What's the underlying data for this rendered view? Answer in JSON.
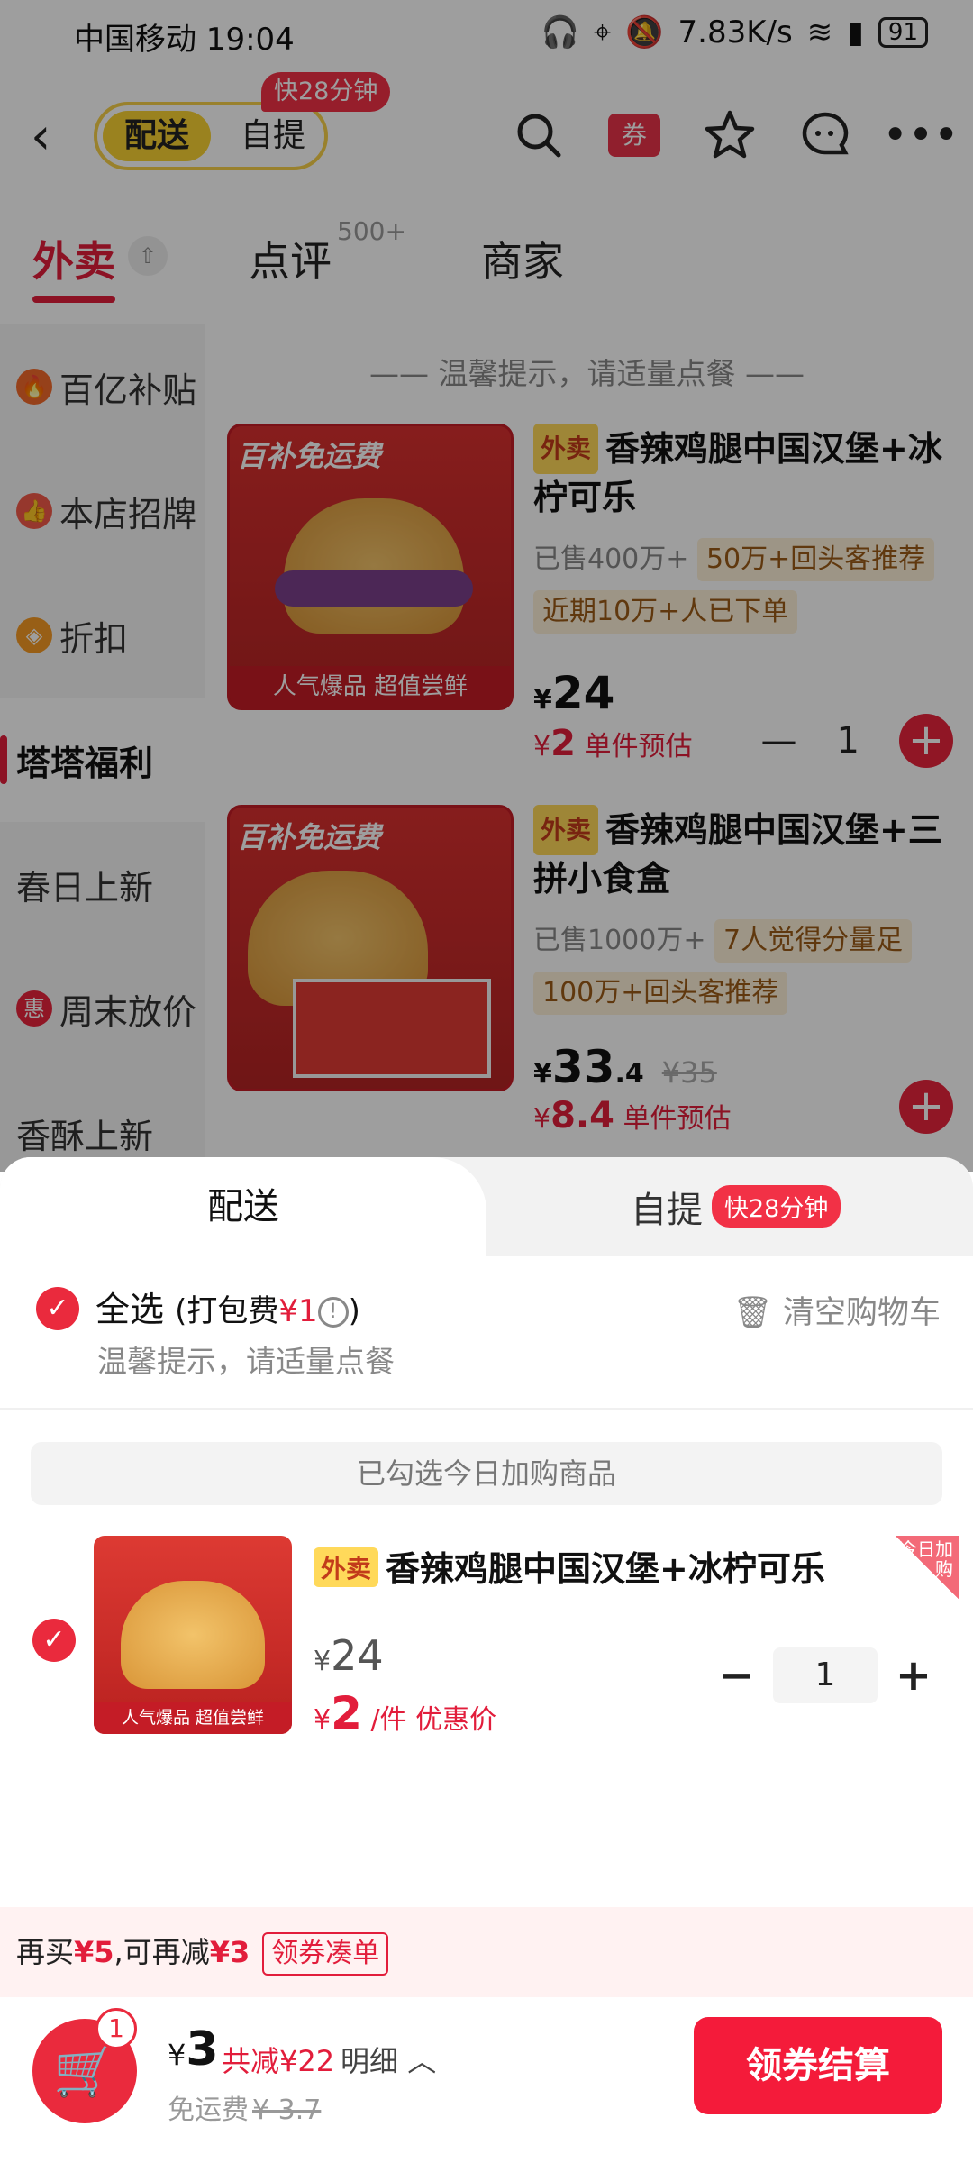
{
  "status_bar": {
    "carrier_time": "中国移动 19:04",
    "net_speed": "7.83K/s",
    "battery": "91"
  },
  "nav": {
    "mode_delivery": "配送",
    "mode_pickup": "自提",
    "fast_badge": "快28分钟",
    "coupon_icon_label": "券"
  },
  "tabs": [
    {
      "label": "外卖"
    },
    {
      "label": "点评",
      "sup": "500+"
    },
    {
      "label": "商家"
    }
  ],
  "sidebar": {
    "items": [
      {
        "label": "百亿补贴",
        "icon": "fire-icon",
        "color": "#f36a2a"
      },
      {
        "label": "本店招牌",
        "icon": "thumb-up-icon",
        "color": "#f35a4a"
      },
      {
        "label": "折扣",
        "icon": "discount-icon",
        "color": "#f59a24"
      },
      {
        "label": "塔塔福利",
        "icon": "",
        "color": ""
      },
      {
        "label": "春日上新",
        "icon": "",
        "color": ""
      },
      {
        "label": "周末放价",
        "icon": "hui-icon",
        "color": "#e8243c",
        "badge": "惠"
      },
      {
        "label": "香酥上新",
        "icon": "",
        "color": ""
      }
    ]
  },
  "menu": {
    "tip": "—— 温馨提示，请适量点餐 ——",
    "products": [
      {
        "ribbon": "百补免运费",
        "slogan": "人气爆品 超值尝鲜",
        "tag": "外卖",
        "title": "香辣鸡腿中国汉堡+冰柠可乐",
        "sold": "已售400万+",
        "chips": [
          "50万+回头客推荐",
          "近期10万+人已下单"
        ],
        "price_symbol": "¥",
        "price": "24",
        "est_symbol": "¥",
        "est_price": "2",
        "est_label": "单件预估",
        "qty": "1"
      },
      {
        "ribbon": "百补免运费",
        "tag": "外卖",
        "title": "香辣鸡腿中国汉堡+三拼小食盒",
        "sold": "已售1000万+",
        "chips": [
          "7人觉得分量足",
          "100万+回头客推荐"
        ],
        "price_symbol": "¥",
        "price": "33",
        "price_decimal": ".4",
        "orig_price": "¥35",
        "est_symbol": "¥",
        "est_price": "8.4",
        "est_label": "单件预估"
      }
    ]
  },
  "sheet": {
    "tab_delivery": "配送",
    "tab_pickup": "自提",
    "fast_badge": "快28分钟",
    "select_all": "全选",
    "packing_prefix": "(打包费",
    "packing_fee": "¥1",
    "packing_suffix": ")",
    "tip": "温馨提示，请适量点餐",
    "clear_cart": "清空购物车",
    "added_today": "已勾选今日加购商品",
    "item": {
      "tag": "外卖",
      "title": "香辣鸡腿中国汉堡+冰柠可乐",
      "corner": "今日加购",
      "price_symbol": "¥",
      "price": "24",
      "unit_symbol": "¥",
      "unit_price": "2",
      "unit_label": "/件 优惠价",
      "qty": "1",
      "slogan": "人气爆品 超值尝鲜"
    }
  },
  "promo": {
    "prefix": "再买",
    "amount1": "¥5",
    "mid": ",可再减",
    "amount2": "¥3",
    "button": "领券凑单"
  },
  "checkout": {
    "cart_count": "1",
    "total_symbol": "¥",
    "total": "3",
    "saved": "共减¥22",
    "detail": "明细",
    "shipping_label": "免运费",
    "shipping_orig": "¥ 3.7",
    "pay_button": "领券结算"
  },
  "colors": {
    "accent": "#e21d3b",
    "brand_yellow": "#f9d232"
  }
}
